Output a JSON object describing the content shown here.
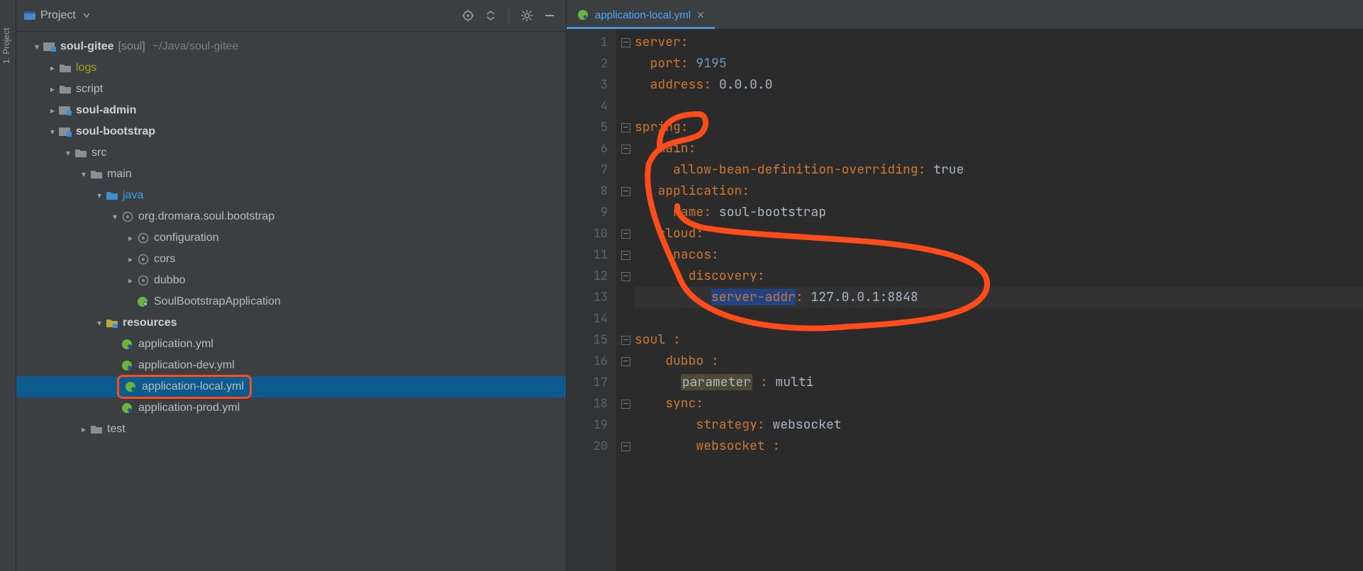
{
  "rail_label": "1: Project",
  "project_header": {
    "title": "Project"
  },
  "editor": {
    "tab_label": "application-local.yml",
    "gutter_start": 1,
    "gutter_end": 20
  },
  "tree": [
    {
      "depth": 0,
      "arrow": "down",
      "icon": "module",
      "label": "soul-gitee",
      "bold": true,
      "moduleText": "[soul]",
      "extra": "~/Java/soul-gitee"
    },
    {
      "depth": 1,
      "arrow": "right",
      "icon": "folder",
      "label": "logs",
      "olive": true
    },
    {
      "depth": 1,
      "arrow": "right",
      "icon": "folder",
      "label": "script"
    },
    {
      "depth": 1,
      "arrow": "right",
      "icon": "module",
      "label": "soul-admin",
      "bold": true
    },
    {
      "depth": 1,
      "arrow": "down",
      "icon": "module",
      "label": "soul-bootstrap",
      "bold": true
    },
    {
      "depth": 2,
      "arrow": "down",
      "icon": "folder",
      "label": "src"
    },
    {
      "depth": 3,
      "arrow": "down",
      "icon": "folder",
      "label": "main"
    },
    {
      "depth": 4,
      "arrow": "down",
      "icon": "srcroot",
      "label": "java",
      "javaBlue": true
    },
    {
      "depth": 5,
      "arrow": "down",
      "icon": "pkg",
      "label": "org.dromara.soul.bootstrap"
    },
    {
      "depth": 6,
      "arrow": "right",
      "icon": "pkg",
      "label": "configuration"
    },
    {
      "depth": 6,
      "arrow": "right",
      "icon": "pkg",
      "label": "cors"
    },
    {
      "depth": 6,
      "arrow": "right",
      "icon": "pkg",
      "label": "dubbo"
    },
    {
      "depth": 6,
      "arrow": "blank",
      "icon": "springapp",
      "label": "SoulBootstrapApplication"
    },
    {
      "depth": 4,
      "arrow": "down",
      "icon": "resroot",
      "label": "resources",
      "bold": true
    },
    {
      "depth": 5,
      "arrow": "blank",
      "icon": "springcfg",
      "label": "application.yml"
    },
    {
      "depth": 5,
      "arrow": "blank",
      "icon": "springcfg",
      "label": "application-dev.yml"
    },
    {
      "depth": 5,
      "arrow": "blank",
      "icon": "springcfg",
      "label": "application-local.yml",
      "selected": true,
      "highlighted": true
    },
    {
      "depth": 5,
      "arrow": "blank",
      "icon": "springcfg",
      "label": "application-prod.yml"
    },
    {
      "depth": 3,
      "arrow": "right",
      "icon": "folder",
      "label": "test"
    }
  ],
  "code": [
    {
      "n": 1,
      "fold": true,
      "segs": [
        [
          "key",
          "server:"
        ]
      ]
    },
    {
      "n": 2,
      "fold": false,
      "segs": [
        [
          "pad",
          "  "
        ],
        [
          "key",
          "port: "
        ],
        [
          "num",
          "9195"
        ]
      ]
    },
    {
      "n": 3,
      "fold": false,
      "segs": [
        [
          "pad",
          "  "
        ],
        [
          "key",
          "address: "
        ],
        [
          "val",
          "0.0.0.0"
        ]
      ]
    },
    {
      "n": 4,
      "fold": false,
      "segs": []
    },
    {
      "n": 5,
      "fold": true,
      "segs": [
        [
          "key",
          "spring:"
        ]
      ]
    },
    {
      "n": 6,
      "fold": true,
      "segs": [
        [
          "pad",
          "   "
        ],
        [
          "key",
          "main:"
        ]
      ]
    },
    {
      "n": 7,
      "fold": false,
      "segs": [
        [
          "pad",
          "     "
        ],
        [
          "key",
          "allow-bean-definition-overriding: "
        ],
        [
          "val",
          "true"
        ]
      ]
    },
    {
      "n": 8,
      "fold": true,
      "segs": [
        [
          "pad",
          "   "
        ],
        [
          "key",
          "application:"
        ]
      ]
    },
    {
      "n": 9,
      "fold": false,
      "segs": [
        [
          "pad",
          "     "
        ],
        [
          "key",
          "name: "
        ],
        [
          "val",
          "soul-bootstrap"
        ]
      ]
    },
    {
      "n": 10,
      "fold": true,
      "segs": [
        [
          "pad",
          "   "
        ],
        [
          "key",
          "cloud:"
        ]
      ]
    },
    {
      "n": 11,
      "fold": true,
      "segs": [
        [
          "pad",
          "     "
        ],
        [
          "key",
          "nacos:"
        ]
      ]
    },
    {
      "n": 12,
      "fold": true,
      "segs": [
        [
          "pad",
          "       "
        ],
        [
          "key",
          "discovery:"
        ]
      ]
    },
    {
      "n": 13,
      "fold": false,
      "hl": true,
      "segs": [
        [
          "pad",
          "          "
        ],
        [
          "selkey",
          "server-addr"
        ],
        [
          "key",
          ": "
        ],
        [
          "val",
          "127.0.0.1:8848"
        ]
      ]
    },
    {
      "n": 14,
      "fold": false,
      "segs": []
    },
    {
      "n": 15,
      "fold": true,
      "segs": [
        [
          "key",
          "soul :"
        ]
      ]
    },
    {
      "n": 16,
      "fold": true,
      "segs": [
        [
          "pad",
          "    "
        ],
        [
          "key",
          "dubbo :"
        ]
      ]
    },
    {
      "n": 17,
      "fold": false,
      "segs": [
        [
          "pad",
          "      "
        ],
        [
          "box",
          "parameter"
        ],
        [
          "key",
          " : "
        ],
        [
          "val",
          "multi"
        ]
      ]
    },
    {
      "n": 18,
      "fold": true,
      "segs": [
        [
          "pad",
          "    "
        ],
        [
          "key",
          "sync:"
        ]
      ]
    },
    {
      "n": 19,
      "fold": false,
      "segs": [
        [
          "pad",
          "        "
        ],
        [
          "key",
          "strategy: "
        ],
        [
          "val",
          "websocket"
        ]
      ]
    },
    {
      "n": 20,
      "fold": true,
      "segs": [
        [
          "pad",
          "        "
        ],
        [
          "key",
          "websocket :"
        ]
      ]
    }
  ]
}
